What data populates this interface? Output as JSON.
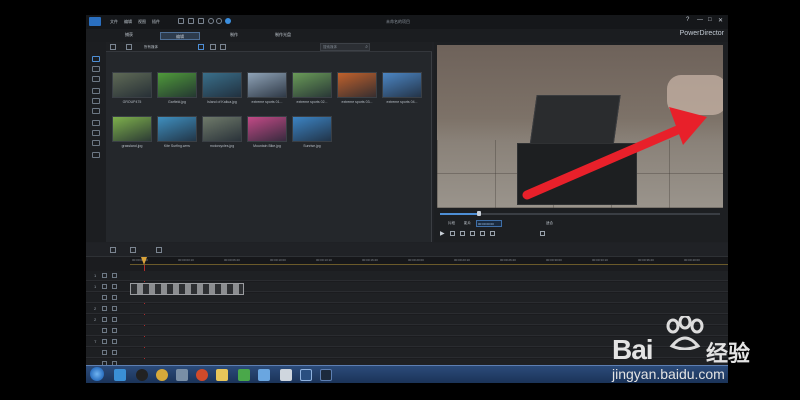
{
  "titlebar": {
    "menu": [
      "文件",
      "编辑",
      "视图",
      "插件"
    ],
    "project_title": "未命名的项目",
    "window_controls": [
      "?",
      "—",
      "□",
      "✕"
    ]
  },
  "tabs": [
    {
      "label": "捕获",
      "active": false
    },
    {
      "label": "编辑",
      "active": true
    },
    {
      "label": "制作",
      "active": false
    },
    {
      "label": "制作光盘",
      "active": false
    }
  ],
  "brand": "PowerDirector",
  "library": {
    "filter_label": "所有媒体",
    "search_placeholder": "搜索媒体",
    "items": [
      {
        "label": "GROUP475",
        "color": "#5f6a56"
      },
      {
        "label": "Garfield.jpg",
        "color": "#4f9a3a"
      },
      {
        "label": "Island of Kailua.jpg",
        "color": "#3a6f8a"
      },
      {
        "label": "extreme sports 01...",
        "color": "#8fa3b7"
      },
      {
        "label": "extreme sports 02...",
        "color": "#6a9b58"
      },
      {
        "label": "extreme sports 03...",
        "color": "#c0612c"
      },
      {
        "label": "extreme sports 04...",
        "color": "#4c86c4"
      },
      {
        "label": "grassland.jpg",
        "color": "#7eb04c"
      },
      {
        "label": "Kite Surfing.wmv",
        "color": "#3f8fbf"
      },
      {
        "label": "motorcycles.jpg",
        "color": "#6f7a6a"
      },
      {
        "label": "Mountain Bike.jpg",
        "color": "#c24a86"
      },
      {
        "label": "Sunrise.jpg",
        "color": "#3c84c4"
      }
    ]
  },
  "preview": {
    "mode_clip": "片段",
    "mode_movie": "影片",
    "timecode": "00:00:00:00",
    "fit_label": "适合"
  },
  "timeline": {
    "ruler_labels": [
      "00:00:00:00",
      "00:00:03:10",
      "00:00:06:20",
      "00:00:10:00",
      "00:00:13:10",
      "00:00:16:20",
      "00:00:20:00",
      "00:00:23:10",
      "00:00:26:20",
      "00:00:30:00",
      "00:00:33:10",
      "00:00:36:20",
      "00:00:40:00"
    ],
    "tracks": [
      "1",
      "1",
      "",
      "2",
      "2",
      "",
      "T",
      "",
      ""
    ]
  },
  "watermark": {
    "brand": "Bai",
    "brand_suffix": "经验",
    "url": "jingyan.baidu.com"
  },
  "colors": {
    "accent": "#4e6f96",
    "arrow": "#e8202a",
    "clip": "#7d7f82"
  }
}
